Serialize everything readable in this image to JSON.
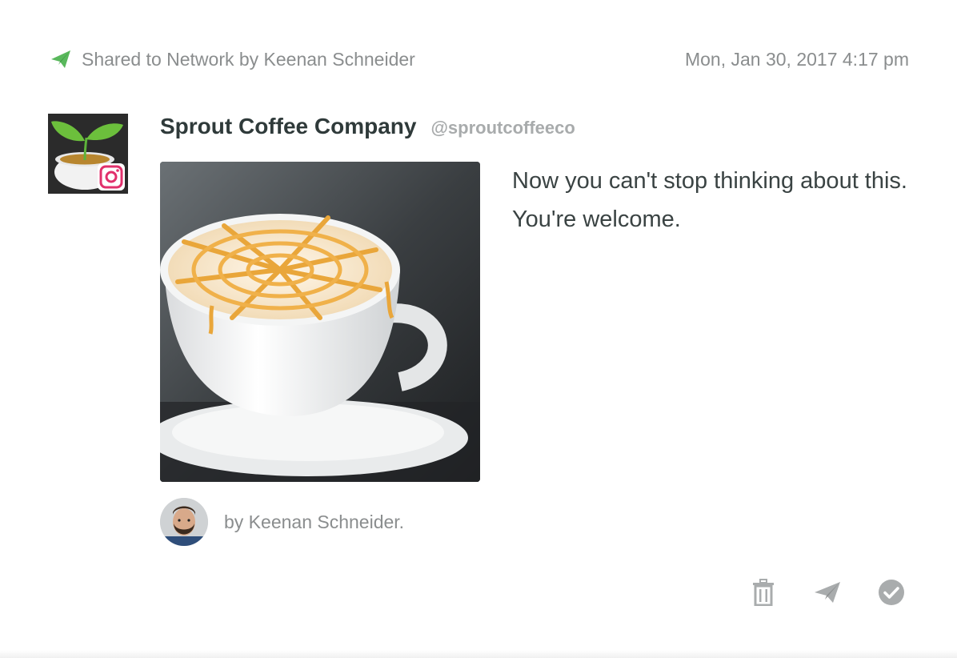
{
  "header": {
    "shared_text": "Shared to Network by Keenan Schneider",
    "timestamp": "Mon, Jan 30, 2017 4:17 pm",
    "shared_icon": "paper-plane-icon",
    "accent_color": "#59b85c"
  },
  "post": {
    "profile_name": "Sprout Coffee Company",
    "profile_handle": "@sproutcoffeeco",
    "network_icon": "instagram-icon",
    "message": "Now you can't stop thinking about this. You're welcome.",
    "photo_alt": "Latte with caramel drizzle"
  },
  "byline": {
    "text": "by Keenan Schneider."
  },
  "actions": [
    {
      "name": "delete",
      "icon": "trash-icon"
    },
    {
      "name": "send",
      "icon": "paper-plane-icon"
    },
    {
      "name": "complete",
      "icon": "check-circle-icon"
    }
  ],
  "colors": {
    "muted_text": "#8a8d8e",
    "title_text": "#2f3a3a",
    "handle_text": "#a8abac",
    "icon_gray": "#a9acad",
    "instagram_pink": "#e1306c"
  }
}
